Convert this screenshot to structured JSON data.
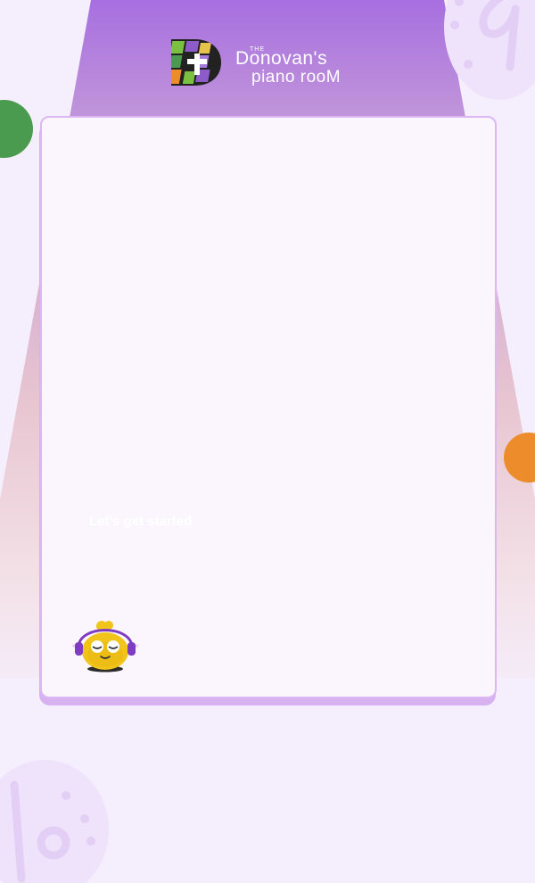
{
  "brand": {
    "small": "THE",
    "line1": "Donovan's",
    "line2": "piano rooM"
  },
  "card": {
    "cta_label": "Let's get started"
  },
  "colors": {
    "accent_purple": "#a76fe0",
    "card_border": "#dbb8f2",
    "green_dot": "#4a9b4f",
    "orange_dot": "#ec8c2b"
  },
  "icons": {
    "logo": "piano-keys-d-logo-icon",
    "mascot": "headphones-chick-mascot-icon",
    "note_top": "music-note-icon",
    "note_bottom": "music-note-icon"
  }
}
